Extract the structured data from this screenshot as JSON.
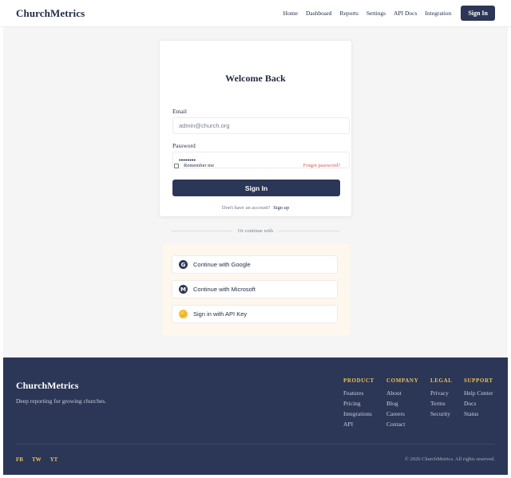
{
  "header": {
    "brand": "ChurchMetrics",
    "nav": [
      "Home",
      "Dashboard",
      "Reports",
      "Settings",
      "API Docs",
      "Integration"
    ],
    "signin_label": "Sign In"
  },
  "login": {
    "title": "Welcome Back",
    "email_label": "Email",
    "email_placeholder": "admin@church.org",
    "password_label": "Password",
    "password_value": "••••••••",
    "remember_label": "Remember me",
    "forgot_label": "Forgot password?",
    "submit_label": "Sign In",
    "signup_prompt": "Don't have an account?",
    "signup_link": "Sign up"
  },
  "alt_login": {
    "divider_text": "Or continue with",
    "google": {
      "icon": "google-icon",
      "glyph": "G",
      "label": "Continue with Google"
    },
    "microsoft": {
      "icon": "microsoft-icon",
      "glyph": "M",
      "label": "Continue with Microsoft"
    },
    "api_key": {
      "icon": "key-icon",
      "glyph": "🔑",
      "label": "Sign in with API Key"
    }
  },
  "footer": {
    "brand": "ChurchMetrics",
    "tagline": "Deep reporting for growing churches.",
    "columns": [
      {
        "title": "PRODUCT",
        "links": [
          "Features",
          "Pricing",
          "Integrations",
          "API"
        ]
      },
      {
        "title": "COMPANY",
        "links": [
          "About",
          "Blog",
          "Careers",
          "Contact"
        ]
      },
      {
        "title": "LEGAL",
        "links": [
          "Privacy",
          "Terms",
          "Security"
        ]
      },
      {
        "title": "SUPPORT",
        "links": [
          "Help Center",
          "Docs",
          "Status"
        ]
      }
    ],
    "socials": [
      "FB",
      "TW",
      "YT"
    ],
    "copyright": "© 2026 ChurchMetrics. All rights reserved."
  },
  "colors": {
    "primary": "#2c3656",
    "accent": "#e8c25a",
    "link_danger": "#d9534f",
    "page_bg": "#f5f5f6",
    "social_panel_bg": "#fdf7ee"
  }
}
